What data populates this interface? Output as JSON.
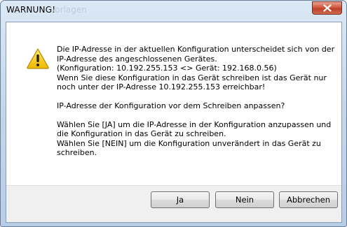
{
  "window": {
    "title": "WARNUNG!",
    "ghost_title": "Vorlagen"
  },
  "icons": {
    "warning": "warning-triangle-icon",
    "close": "close-icon"
  },
  "message": {
    "lines": [
      "Die IP-Adresse in der aktuellen Konfiguration unterscheidet sich von der",
      "IP-Adresse des angeschlossenen Gerätes.",
      " (Konfiguration: 10.192.255.153 <> Gerät: 192.168.0.56)",
      "Wenn Sie diese Konfiguration in das Gerät schreiben ist das Gerät nur",
      "noch unter der IP-Adresse 10.192.255.153 erreichbar!",
      "",
      "IP-Adresse der Konfiguration vor dem Schreiben anpassen?",
      "",
      "Wählen Sie [JA] um die IP-Adresse in der Konfiguration anzupassen und",
      "die Konfiguration in das Gerät zu schreiben.",
      "Wählen Sie [NEIN] um die Konfiguration unverändert in das Gerät zu",
      "schreiben."
    ]
  },
  "buttons": {
    "yes": "Ja",
    "no": "Nein",
    "cancel": "Abbrechen"
  },
  "colors": {
    "titlebar": "#c4d7ec",
    "close_button": "#c0402b",
    "warning_yellow": "#f5c400"
  }
}
